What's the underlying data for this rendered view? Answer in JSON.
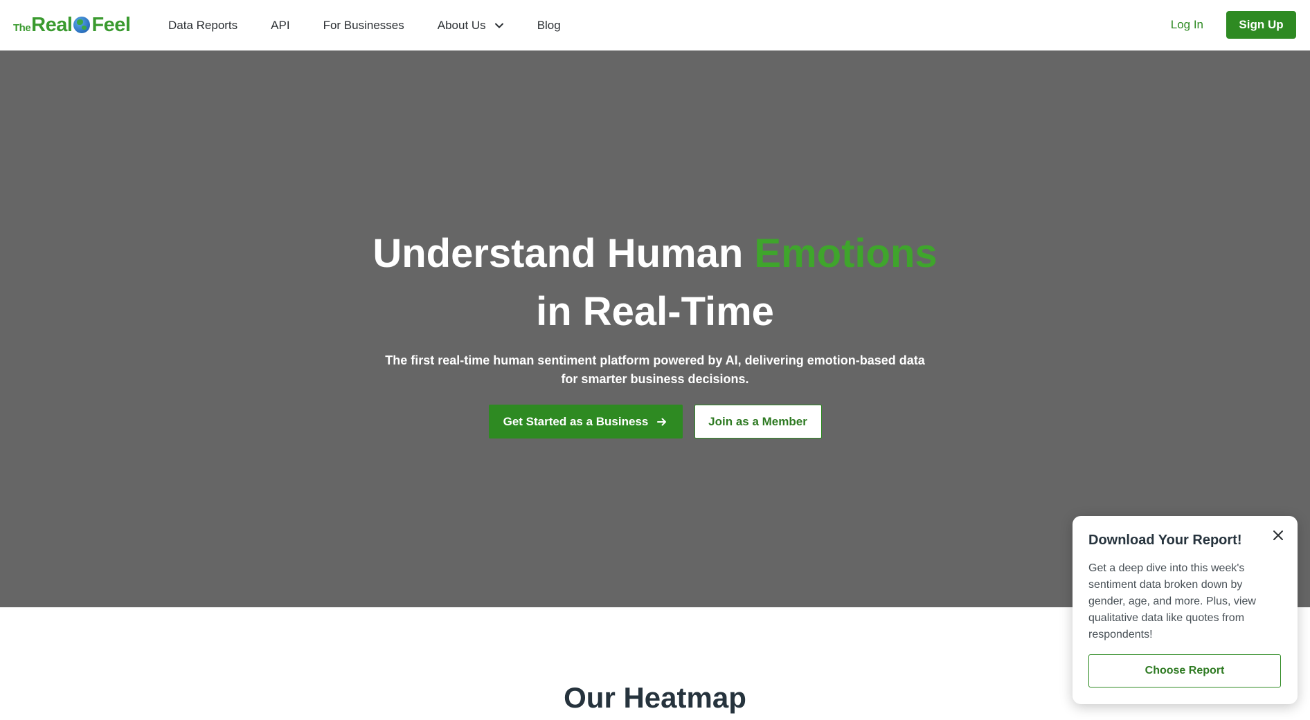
{
  "logo": {
    "the": "The",
    "real": "Real",
    "feel": "Feel"
  },
  "nav": {
    "items": [
      {
        "label": "Data Reports"
      },
      {
        "label": "API"
      },
      {
        "label": "For Businesses"
      },
      {
        "label": "About Us",
        "has_dropdown": true,
        "icon": "chevron-down-icon"
      },
      {
        "label": "Blog"
      }
    ],
    "login_label": "Log In",
    "signup_label": "Sign Up"
  },
  "hero": {
    "title_part1": "Understand Human ",
    "title_accent": "Emotions",
    "title_line2": "in Real-Time",
    "subtitle": "The first real-time human sentiment platform powered by AI, delivering emotion-based data for smarter business decisions.",
    "primary_cta": "Get Started as a Business",
    "primary_cta_icon": "arrow-right-icon",
    "secondary_cta": "Join as a Member",
    "background_color": "#666666"
  },
  "section": {
    "title": "Our Heatmap"
  },
  "popup": {
    "title": "Download Your Report!",
    "close_icon": "close-icon",
    "body": "Get a deep dive into this week's sentiment data broken down by gender, age, and more. Plus, view qualitative data like quotes from respondents!",
    "button_label": "Choose Report"
  },
  "colors": {
    "brand_green": "#2e8a22",
    "accent_green": "#3fa52c",
    "text_dark": "#26333d"
  }
}
